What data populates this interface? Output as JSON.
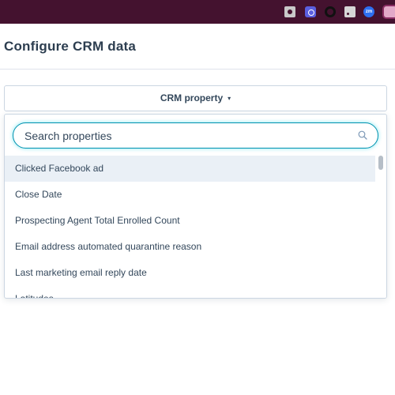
{
  "browser": {
    "extensions": [
      "camera-icon",
      "gear-icon",
      "circle-icon",
      "rss-icon",
      "zoom-icon",
      "profile-icon"
    ],
    "zoom_icon_text": "zm"
  },
  "page": {
    "title": "Configure CRM data"
  },
  "crm_button": {
    "label": "CRM property",
    "caret": "▾"
  },
  "dropdown": {
    "search_placeholder": "Search properties",
    "search_value": "",
    "items": [
      "Clicked Facebook ad",
      "Close Date",
      "Prospecting Agent Total Enrolled Count",
      "Email address automated quarantine reason",
      "Last marketing email reply date",
      "Latitudes"
    ],
    "highlighted_index": 0
  },
  "colors": {
    "topbar": "#44122f",
    "focus_ring": "#0091ae",
    "highlight": "#eaf0f6",
    "text": "#33475b"
  }
}
